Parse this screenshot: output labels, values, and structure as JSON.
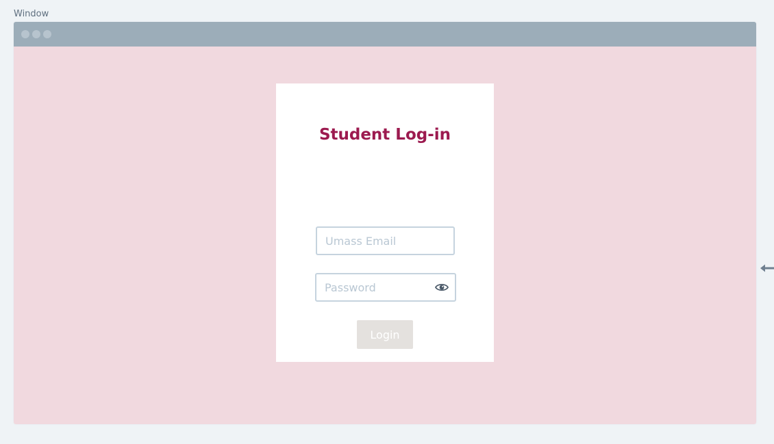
{
  "canvas": {
    "label": "Window"
  },
  "window": {
    "titlebar_dots": [
      "dot",
      "dot",
      "dot"
    ]
  },
  "login_card": {
    "title": "Student Log-in",
    "email_placeholder": "Umass Email",
    "email_value": "",
    "password_placeholder": "Password",
    "password_value": "",
    "password_toggle_icon": "eye-icon",
    "login_label": "Login"
  },
  "icons": {
    "side_arrow": "arrow-left-icon"
  },
  "colors": {
    "page_background": "#eff3f6",
    "titlebar": "#9cadb9",
    "window_content": "#f1d9df",
    "card": "#ffffff",
    "title_text": "#9c1a4f",
    "field_border": "#c5d3de",
    "login_button": "#e4e1de"
  }
}
